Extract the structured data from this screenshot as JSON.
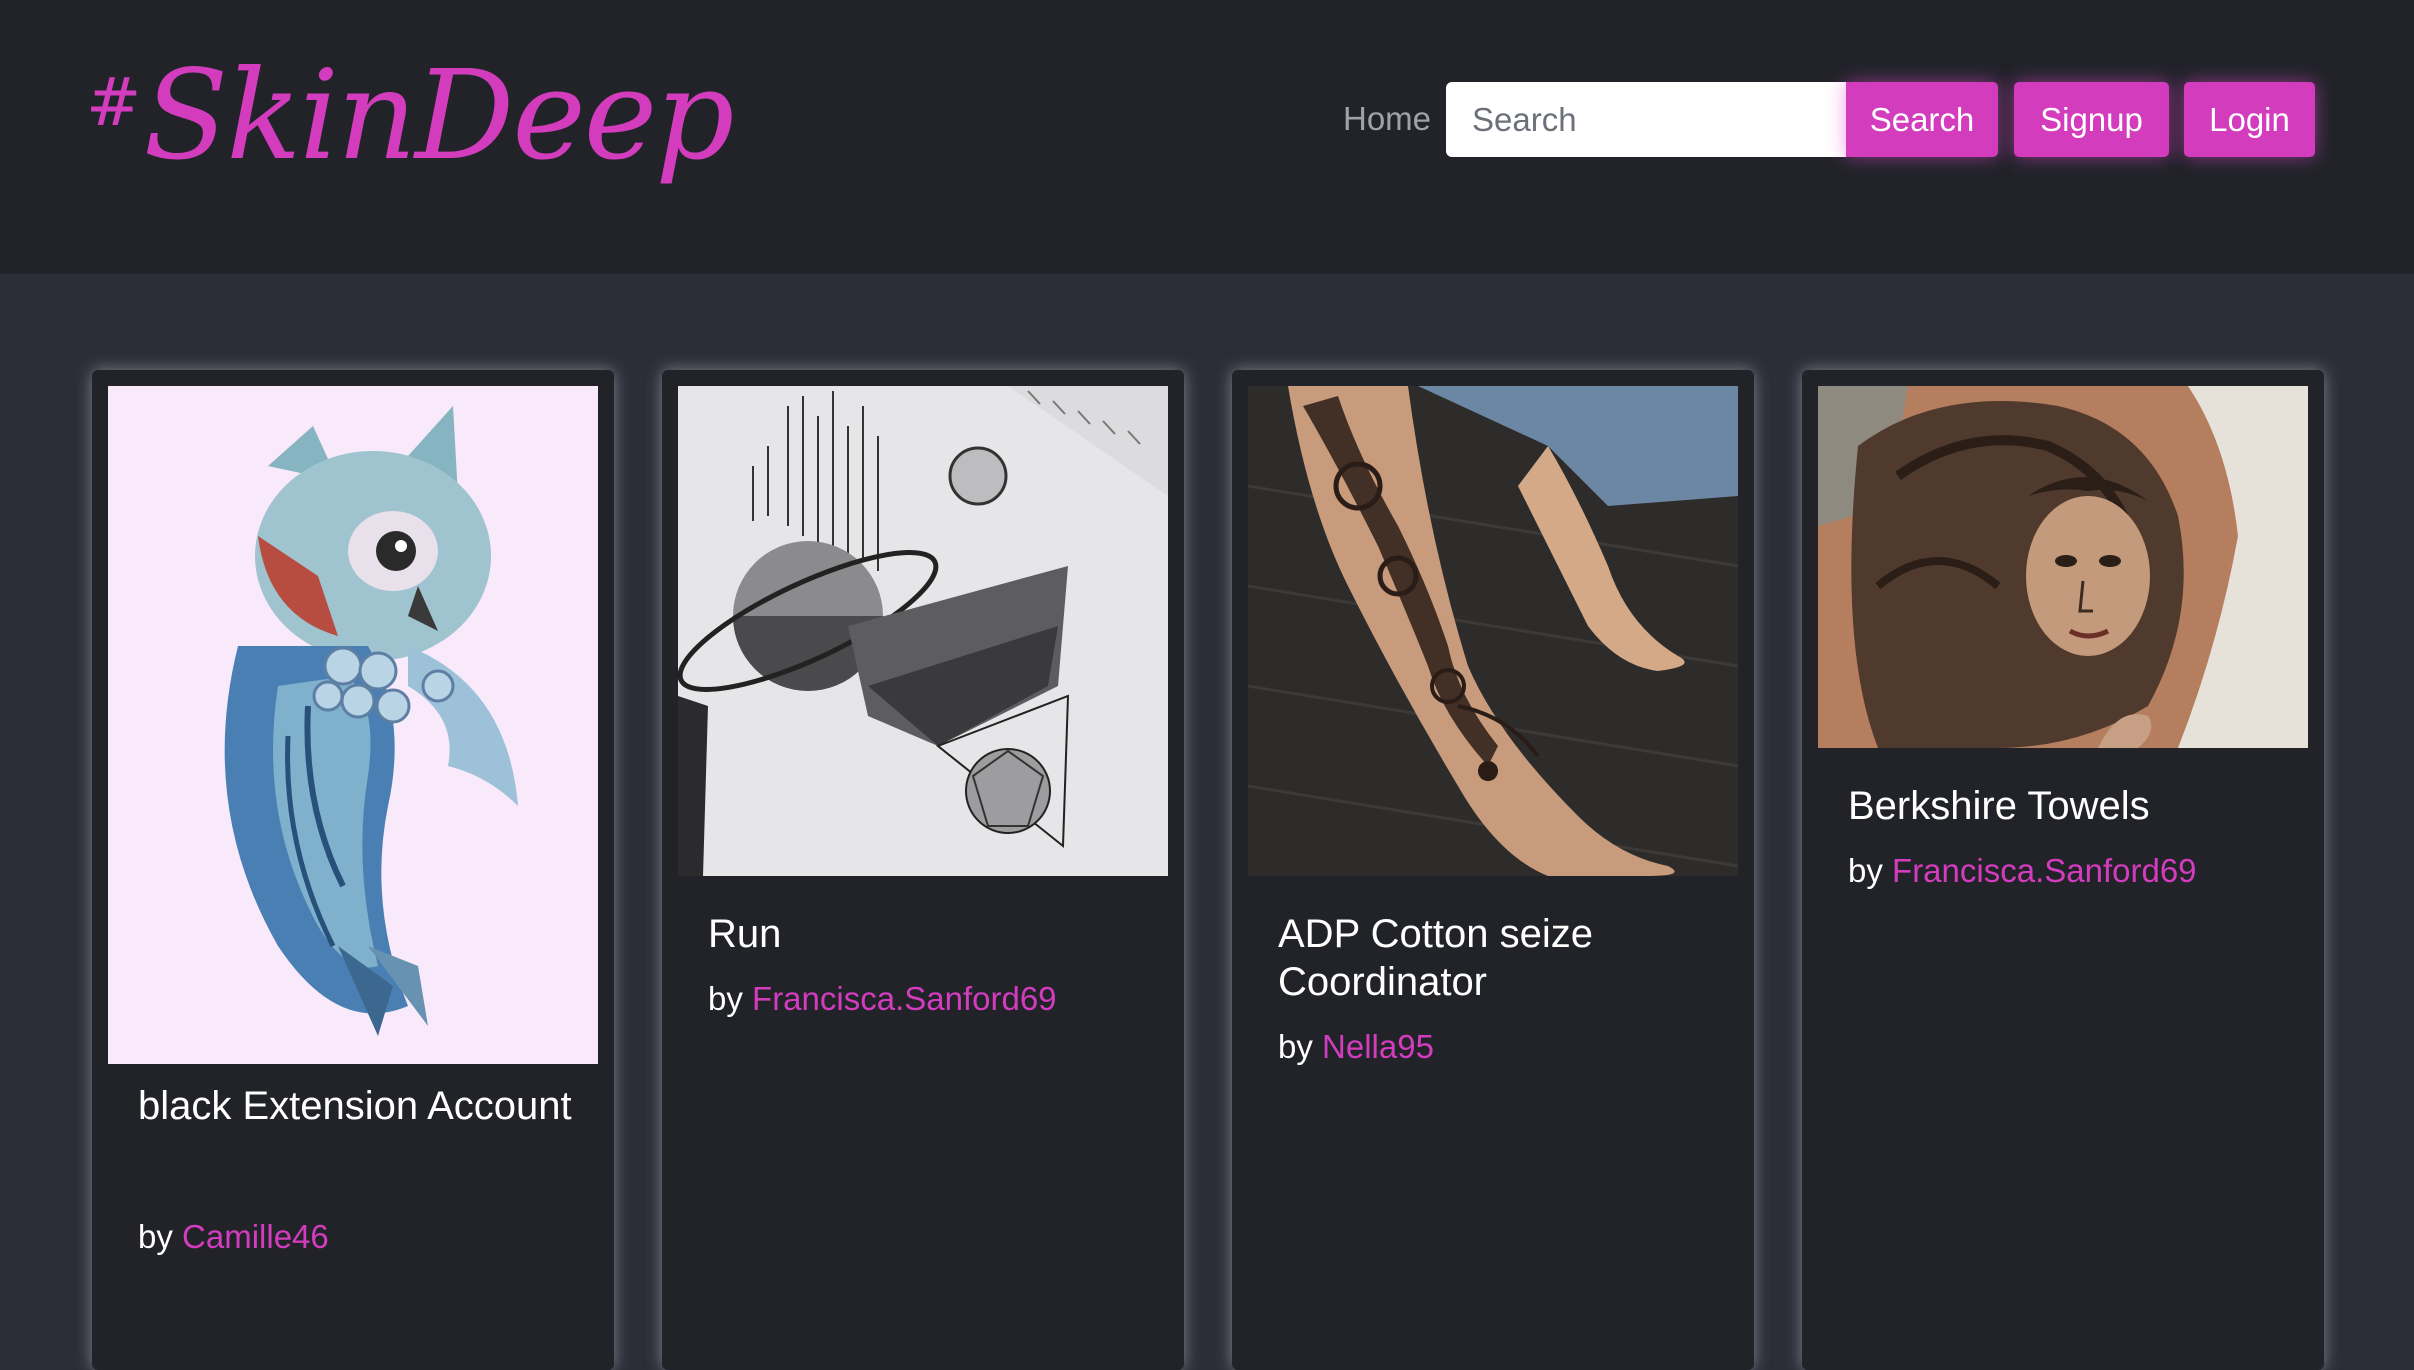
{
  "brand": {
    "logo_text": "SkinDeep",
    "logo_hash": "#"
  },
  "nav": {
    "home_label": "Home",
    "search_placeholder": "Search",
    "search_button": "Search",
    "signup_button": "Signup",
    "login_button": "Login"
  },
  "colors": {
    "accent": "#d23cbd",
    "navbar_bg": "#212329",
    "page_bg": "#2b2e37",
    "card_bg": "#212329"
  },
  "cards": [
    {
      "title": "black Extension Account",
      "by_label": "by",
      "author": "Camille46",
      "image": "owl tattoo illustration"
    },
    {
      "title": "Run",
      "by_label": "by",
      "author": "Francisca.Sanford69",
      "image": "planet geometric sketch"
    },
    {
      "title": "ADP Cotton seize Coordinator",
      "by_label": "by",
      "author": "Nella95",
      "image": "mandala leg tattoo"
    },
    {
      "title": "Berkshire Towels",
      "by_label": "by",
      "author": "Francisca.Sanford69",
      "image": "medusa shoulder tattoo"
    }
  ]
}
